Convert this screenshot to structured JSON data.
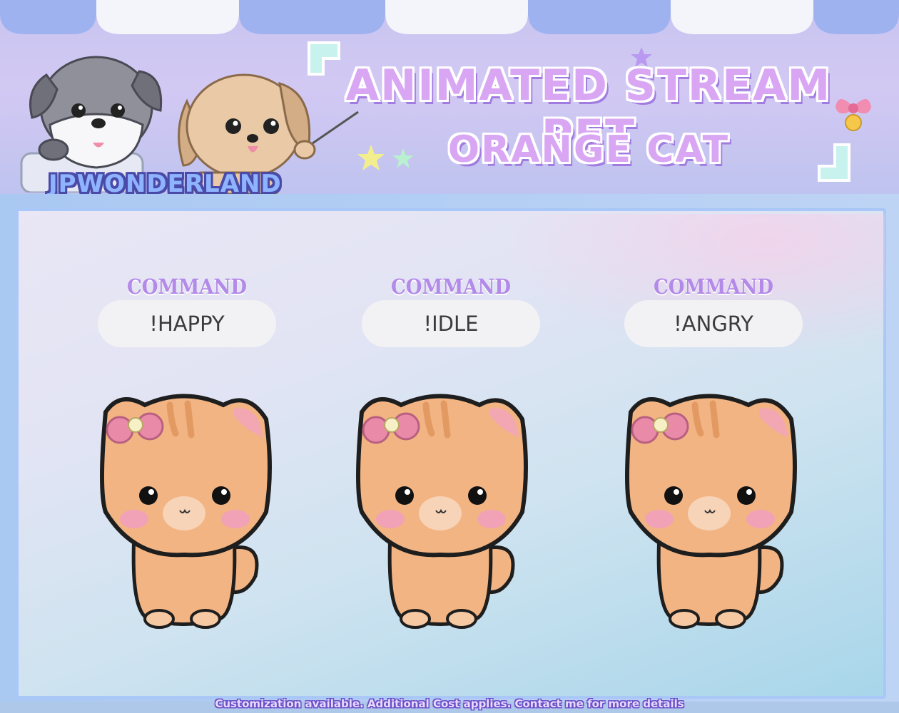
{
  "header": {
    "title": "ANIMATED STREAM PET",
    "subtitle": "ORANGE CAT",
    "brand": "JPWONDERLAND"
  },
  "commands": [
    {
      "label": "COMMAND",
      "value": "!HAPPY"
    },
    {
      "label": "COMMAND",
      "value": "!IDLE"
    },
    {
      "label": "COMMAND",
      "value": "!ANGRY"
    }
  ],
  "footer": {
    "note": "Customization available. Additional Cost applies. Contact me for more details"
  },
  "colors": {
    "title_fill": "#d9a6f3",
    "title_shadow": "#a27be0",
    "brand_fill": "#8fb4ff",
    "command_label": "#b48ae8",
    "cat_fur": "#f2b483",
    "cat_stripe": "#e39a62",
    "bow": "#e98aa8"
  },
  "icons": [
    "schnauzer-dog-icon",
    "golden-puppy-icon",
    "star-icon",
    "music-note-icon",
    "bow-bell-icon",
    "orange-cat-icon"
  ]
}
